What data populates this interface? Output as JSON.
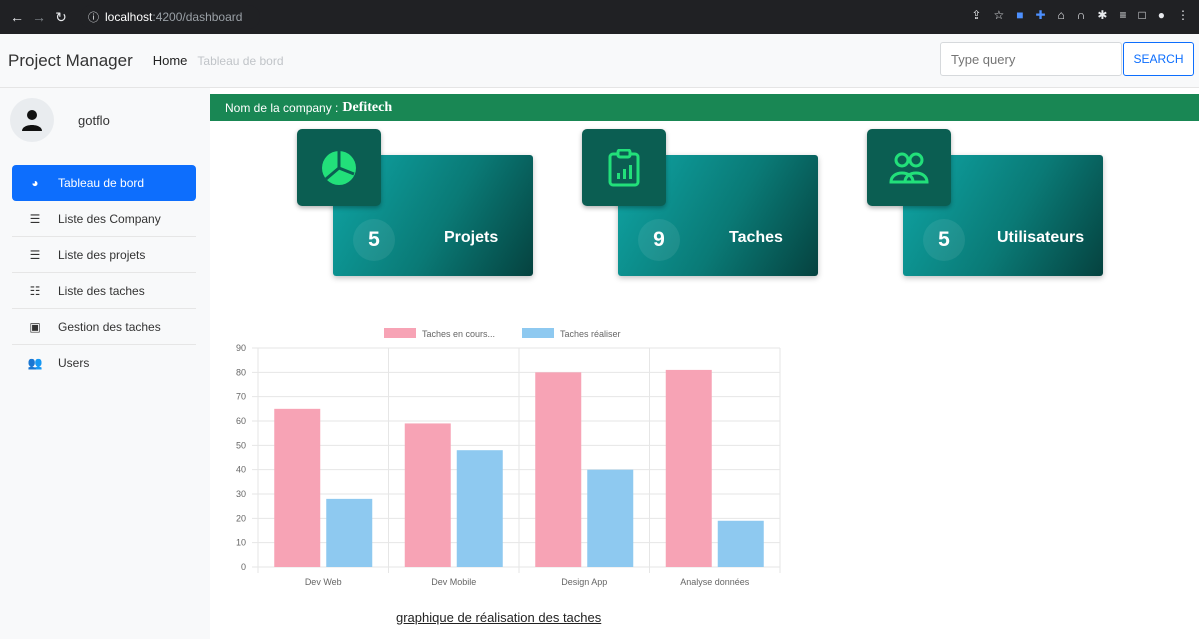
{
  "browser": {
    "url_host": "localhost",
    "url_path": ":4200/dashboard"
  },
  "navbar": {
    "brand": "Project Manager",
    "home": "Home",
    "breadcrumb": "Tableau de bord",
    "search_placeholder": "Type query",
    "search_label": "SEARCH"
  },
  "sidebar": {
    "username": "gotflo",
    "items": [
      {
        "label": "Tableau de bord",
        "icon": "dashboard-icon",
        "active": true
      },
      {
        "label": "Liste des Company",
        "icon": "list-icon"
      },
      {
        "label": "Liste des projets",
        "icon": "list-icon"
      },
      {
        "label": "Liste des taches",
        "icon": "checklist-icon"
      },
      {
        "label": "Gestion des taches",
        "icon": "clipboard-icon"
      },
      {
        "label": "Users",
        "icon": "users-icon"
      }
    ]
  },
  "company": {
    "label": "Nom de la company :",
    "name": "Defitech"
  },
  "stats": [
    {
      "value": "5",
      "label": "Projets",
      "icon": "pie-chart-icon"
    },
    {
      "value": "9",
      "label": "Taches",
      "icon": "clipboard-chart-icon"
    },
    {
      "value": "5",
      "label": "Utilisateurs",
      "icon": "users-icon"
    }
  ],
  "colors": {
    "primary": "#0d6efd",
    "company_bar": "#198754",
    "card_teal": "#0a7a76",
    "series_pink": "#f7a3b5",
    "series_blue": "#8ec9f0"
  },
  "chart_data": {
    "type": "bar",
    "categories": [
      "Dev Web",
      "Dev Mobile",
      "Design App",
      "Analyse données"
    ],
    "series": [
      {
        "name": "Taches en cours...",
        "values": [
          65,
          59,
          80,
          81
        ],
        "color": "#f7a3b5"
      },
      {
        "name": "Taches réaliser",
        "values": [
          28,
          48,
          40,
          19
        ],
        "color": "#8ec9f0"
      }
    ],
    "ylim": [
      0,
      90
    ],
    "yticks": [
      0,
      10,
      20,
      30,
      40,
      50,
      60,
      70,
      80,
      90
    ],
    "legend": "top-center",
    "grid": true,
    "caption": "graphique de réalisation des taches"
  }
}
